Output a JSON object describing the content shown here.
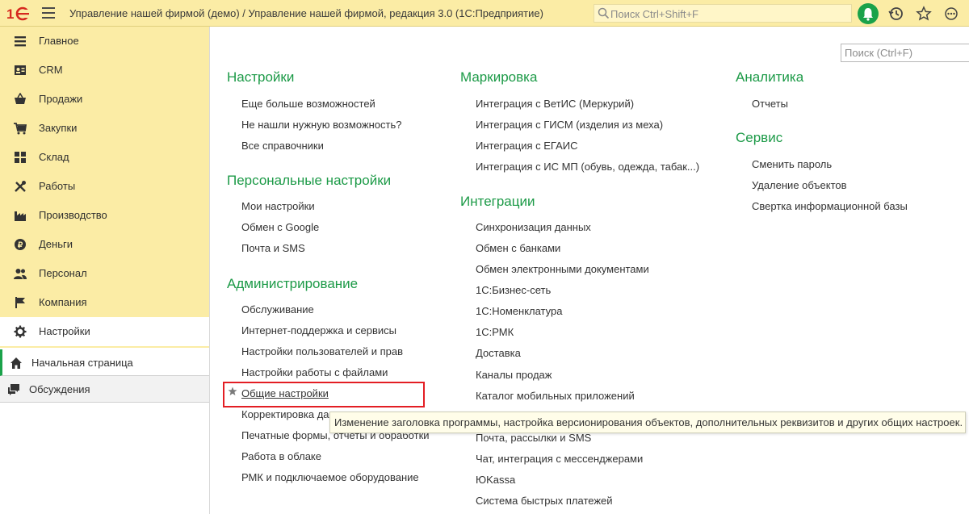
{
  "header": {
    "title": "Управление нашей фирмой (демо) / Управление нашей фирмой, редакция 3.0  (1С:Предприятие)",
    "search_placeholder": "Поиск Ctrl+Shift+F",
    "icons": [
      "1c-logo-icon",
      "menu-icon",
      "search-icon",
      "notifications-bell-icon",
      "history-icon",
      "favorites-star-icon",
      "more-icon"
    ]
  },
  "sidebar": {
    "items": [
      {
        "label": "Главное",
        "icon": "home-list-icon"
      },
      {
        "label": "CRM",
        "icon": "crm-card-icon"
      },
      {
        "label": "Продажи",
        "icon": "basket-icon"
      },
      {
        "label": "Закупки",
        "icon": "cart-icon"
      },
      {
        "label": "Склад",
        "icon": "warehouse-grid-icon"
      },
      {
        "label": "Работы",
        "icon": "tools-icon"
      },
      {
        "label": "Производство",
        "icon": "factory-icon"
      },
      {
        "label": "Деньги",
        "icon": "coin-icon"
      },
      {
        "label": "Персонал",
        "icon": "people-icon"
      },
      {
        "label": "Компания",
        "icon": "flag-icon"
      },
      {
        "label": "Настройки",
        "icon": "gear-icon",
        "active": true
      }
    ],
    "lower": [
      {
        "label": "Начальная страница",
        "icon": "home-icon"
      },
      {
        "label": "Обсуждения",
        "icon": "chat-icon"
      }
    ]
  },
  "main": {
    "search_placeholder": "Поиск (Ctrl+F)",
    "columns": [
      {
        "sections": [
          {
            "title": "Настройки",
            "links": [
              "Еще больше возможностей",
              "Не нашли нужную возможность?",
              "Все справочники"
            ]
          },
          {
            "title": "Персональные настройки",
            "links": [
              "Мои настройки",
              "Обмен с Google",
              "Почта и SMS"
            ]
          },
          {
            "title": "Администрирование",
            "links": [
              "Обслуживание",
              "Интернет-поддержка и сервисы",
              "Настройки пользователей и прав",
              "Настройки работы с файлами",
              "Общие настройки",
              "Корректировка да",
              "Печатные формы, отчеты и обработки",
              "Работа в облаке",
              "РМК и подключаемое оборудование"
            ]
          }
        ]
      },
      {
        "sections": [
          {
            "title": "Маркировка",
            "links": [
              "Интеграция с ВетИС (Меркурий)",
              "Интеграция с ГИСМ (изделия из меха)",
              "Интеграция с ЕГАИС",
              "Интеграция с ИС МП (обувь, одежда, табак...)"
            ]
          },
          {
            "title": "Интеграции",
            "links": [
              "Синхронизация данных",
              "Обмен с банками",
              "Обмен электронными документами",
              "1С:Бизнес-сеть",
              "1С:Номенклатура",
              "1С:РМК",
              "Доставка",
              "Каналы продаж",
              "Каталог мобильных приложений",
              "",
              "Почта, рассылки и SMS",
              "Чат, интеграция с мессенджерами",
              "ЮKassa",
              "Система быстрых платежей"
            ]
          }
        ]
      },
      {
        "sections": [
          {
            "title": "Аналитика",
            "links": [
              "Отчеты"
            ]
          },
          {
            "title": "Сервис",
            "links": [
              "Сменить пароль",
              "Удаление объектов",
              "Свертка информационной базы"
            ]
          }
        ]
      }
    ],
    "tooltip": "Изменение заголовка программы, настройка версионирования объектов, дополнительных реквизитов и других общих настроек."
  },
  "colors": {
    "accent_green": "#1c9a47",
    "sidebar_bg": "#fbeca5",
    "highlight_red": "#e31e24"
  }
}
